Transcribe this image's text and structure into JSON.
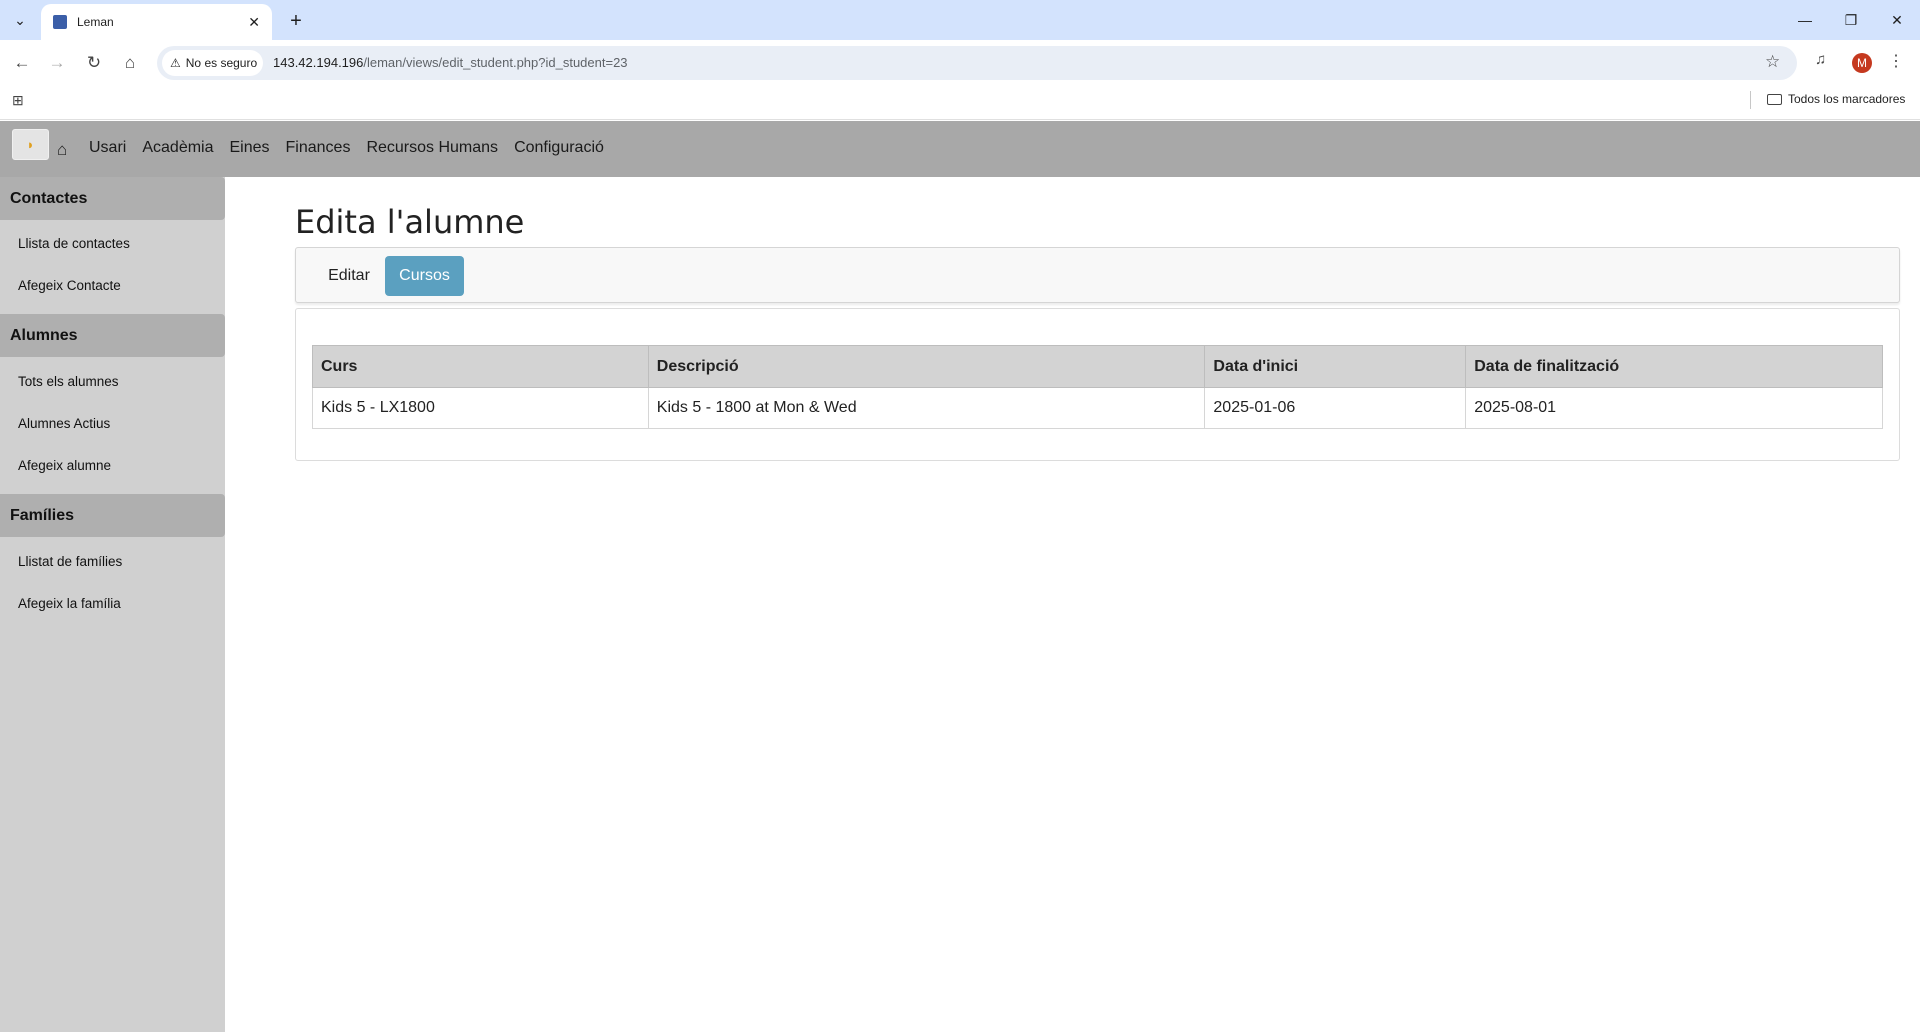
{
  "browser": {
    "tab_title": "Leman",
    "tab_close": "✕",
    "new_tab": "+",
    "security_label": "No es seguro",
    "url_host": "143.42.194.196",
    "url_path": "/leman/views/edit_student.php?id_student=23",
    "profile_initial": "M",
    "bookmarks_all": "Todos los marcadores",
    "icons": [
      "tab-search-icon",
      "close-icon",
      "plus-icon",
      "minimize-icon",
      "restore-icon",
      "window-close-icon",
      "back-arrow-icon",
      "forward-arrow-icon",
      "reload-icon",
      "home-icon",
      "warning-icon",
      "star-icon",
      "media-icon",
      "kebab-icon",
      "apps-icon",
      "folder-icon"
    ]
  },
  "app": {
    "nav": [
      "Usari",
      "Acadèmia",
      "Eines",
      "Finances",
      "Recursos Humans",
      "Configuració"
    ],
    "sidebar": {
      "sections": [
        {
          "title": "Contactes",
          "links": [
            "Llista de contactes",
            "Afegeix Contacte"
          ]
        },
        {
          "title": "Alumnes",
          "links": [
            "Tots els alumnes",
            "Alumnes Actius",
            "Afegeix alumne"
          ]
        },
        {
          "title": "Famílies",
          "links": [
            "Llistat de famílies",
            "Afegeix la família"
          ]
        }
      ]
    },
    "page_title": "Edita l'alumne",
    "tabs": {
      "editar": "Editar",
      "cursos": "Cursos"
    },
    "table": {
      "headers": [
        "Curs",
        "Descripció",
        "Data d'inici",
        "Data de finalització"
      ],
      "rows": [
        [
          "Kids 5 - LX1800",
          "Kids 5 - 1800 at Mon & Wed",
          "2025-01-06",
          "2025-08-01"
        ]
      ]
    }
  },
  "colors": {
    "browser_tabstrip": "#d3e3fd",
    "appbar": "#a8a8a8",
    "sidebar": "#d0d0d0",
    "sidebar_head": "#afafaf",
    "active_tab": "#5ba0c0",
    "table_header": "#d3d3d3"
  }
}
